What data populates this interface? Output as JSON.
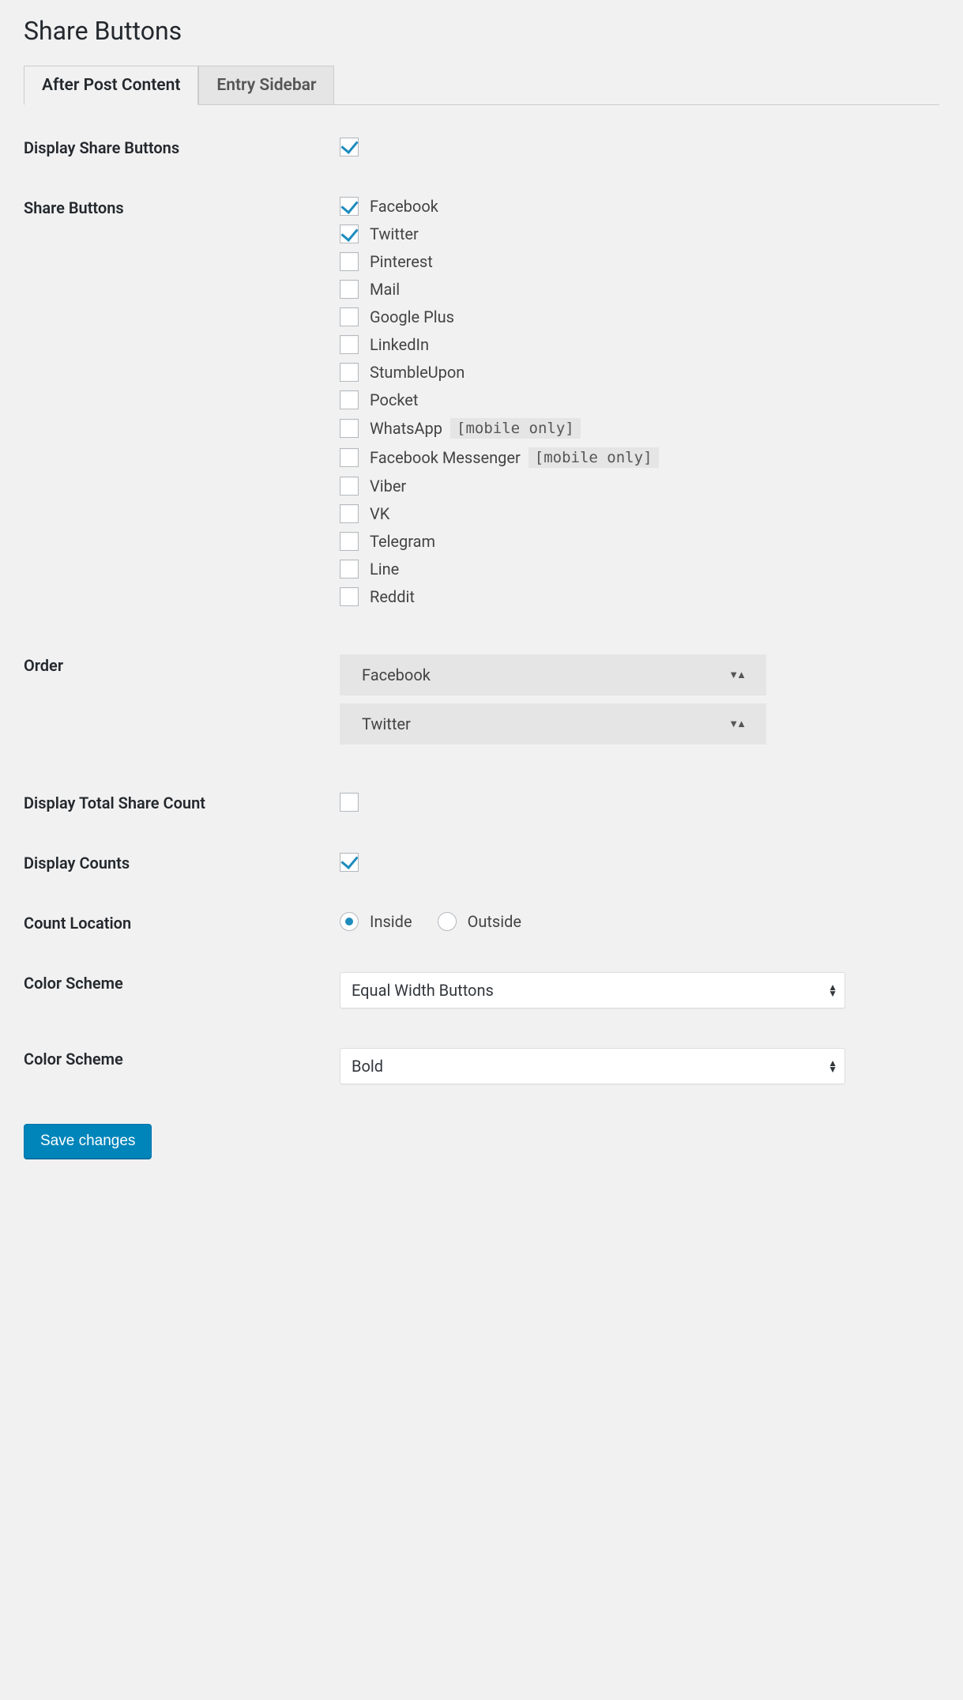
{
  "page_title": "Share Buttons",
  "tabs": [
    {
      "label": "After Post Content",
      "active": true
    },
    {
      "label": "Entry Sidebar",
      "active": false
    }
  ],
  "labels": {
    "display_share_buttons": "Display Share Buttons",
    "share_buttons": "Share Buttons",
    "order": "Order",
    "display_total_share_count": "Display Total Share Count",
    "display_counts": "Display Counts",
    "count_location": "Count Location",
    "color_scheme_1": "Color Scheme",
    "color_scheme_2": "Color Scheme"
  },
  "display_share_buttons": true,
  "share_buttons": [
    {
      "label": "Facebook",
      "checked": true,
      "badge": null
    },
    {
      "label": "Twitter",
      "checked": true,
      "badge": null
    },
    {
      "label": "Pinterest",
      "checked": false,
      "badge": null
    },
    {
      "label": "Mail",
      "checked": false,
      "badge": null
    },
    {
      "label": "Google Plus",
      "checked": false,
      "badge": null
    },
    {
      "label": "LinkedIn",
      "checked": false,
      "badge": null
    },
    {
      "label": "StumbleUpon",
      "checked": false,
      "badge": null
    },
    {
      "label": "Pocket",
      "checked": false,
      "badge": null
    },
    {
      "label": "WhatsApp",
      "checked": false,
      "badge": "[mobile only]"
    },
    {
      "label": "Facebook Messenger",
      "checked": false,
      "badge": "[mobile only]"
    },
    {
      "label": "Viber",
      "checked": false,
      "badge": null
    },
    {
      "label": "VK",
      "checked": false,
      "badge": null
    },
    {
      "label": "Telegram",
      "checked": false,
      "badge": null
    },
    {
      "label": "Line",
      "checked": false,
      "badge": null
    },
    {
      "label": "Reddit",
      "checked": false,
      "badge": null
    }
  ],
  "order": [
    {
      "label": "Facebook"
    },
    {
      "label": "Twitter"
    }
  ],
  "display_total_share_count": false,
  "display_counts": true,
  "count_location": {
    "options": [
      {
        "label": "Inside",
        "checked": true
      },
      {
        "label": "Outside",
        "checked": false
      }
    ]
  },
  "select_1": {
    "value": "Equal Width Buttons"
  },
  "select_2": {
    "value": "Bold"
  },
  "submit_label": "Save changes"
}
